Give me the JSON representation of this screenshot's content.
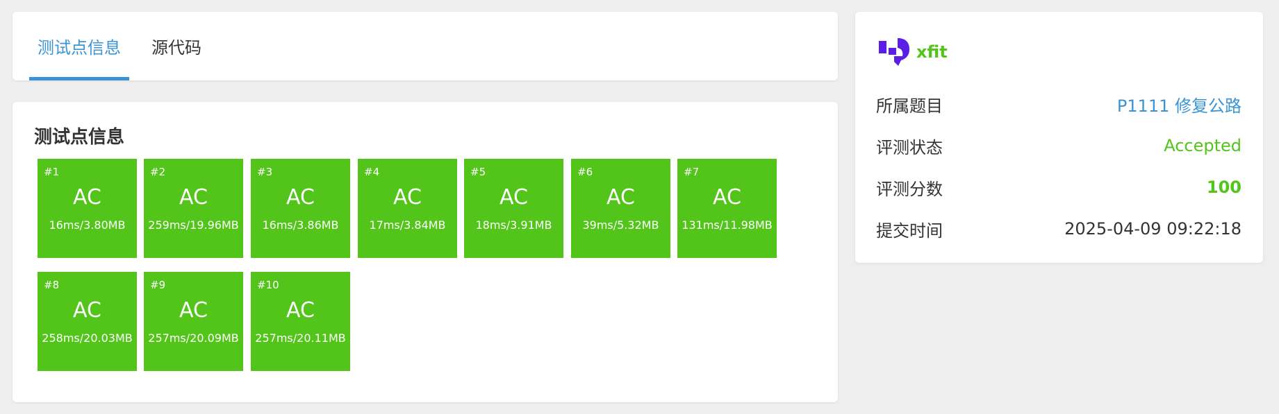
{
  "tabs": {
    "items": [
      {
        "label": "测试点信息"
      },
      {
        "label": "源代码"
      }
    ]
  },
  "tests": {
    "title": "测试点信息",
    "points": [
      {
        "id": "#1",
        "status": "AC",
        "result": "16ms/3.80MB"
      },
      {
        "id": "#2",
        "status": "AC",
        "result": "259ms/19.96MB"
      },
      {
        "id": "#3",
        "status": "AC",
        "result": "16ms/3.86MB"
      },
      {
        "id": "#4",
        "status": "AC",
        "result": "17ms/3.84MB"
      },
      {
        "id": "#5",
        "status": "AC",
        "result": "18ms/3.91MB"
      },
      {
        "id": "#6",
        "status": "AC",
        "result": "39ms/5.32MB"
      },
      {
        "id": "#7",
        "status": "AC",
        "result": "131ms/11.98MB"
      },
      {
        "id": "#8",
        "status": "AC",
        "result": "258ms/20.03MB"
      },
      {
        "id": "#9",
        "status": "AC",
        "result": "257ms/20.09MB"
      },
      {
        "id": "#10",
        "status": "AC",
        "result": "257ms/20.11MB"
      }
    ]
  },
  "info": {
    "brand_name": "xfit",
    "rows": [
      {
        "label": "所属题目",
        "value": "P1111 修复公路"
      },
      {
        "label": "评测状态",
        "value": "Accepted"
      },
      {
        "label": "评测分数",
        "value": "100"
      },
      {
        "label": "提交时间",
        "value": "2025-04-09 09:22:18"
      }
    ]
  },
  "colors": {
    "accent_blue": "#3a94d4",
    "ac_green": "#52c41a",
    "logo_purple": "#5a1ee6",
    "background": "#eeeeee"
  },
  "icons": {
    "brand_logo": "xfit-logo-icon"
  }
}
